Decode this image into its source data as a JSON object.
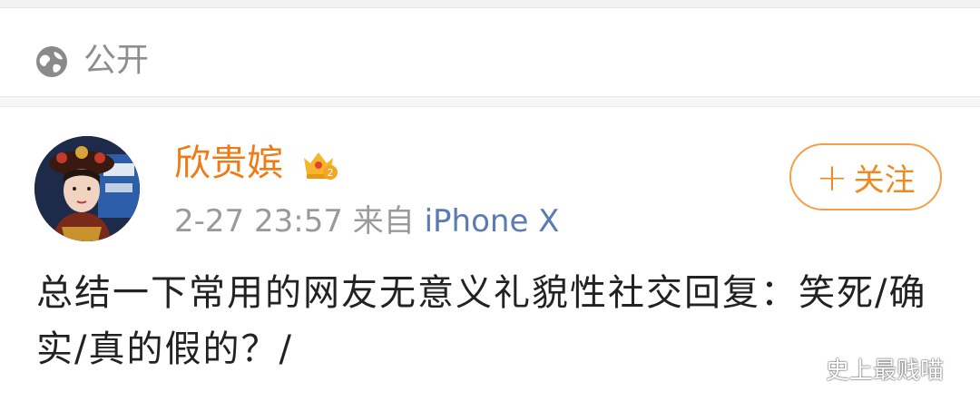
{
  "visibility": {
    "icon": "globe-icon",
    "label": "公开"
  },
  "post": {
    "author": {
      "name": "欣贵嫔",
      "badge_icon": "crown-badge-icon"
    },
    "date": "2-27 23:57",
    "source_prefix": "来自",
    "source_device": "iPhone X",
    "follow_label": "关注",
    "text": "总结一下常用的网友无意义礼貌性社交回复：笑死/确实/真的假的？/"
  },
  "watermark": {
    "icon": "wechat-icon",
    "text": "史上最贱喵"
  },
  "colors": {
    "username": "#f07a14",
    "follow_border": "#f3a046",
    "device_link": "#5b7bb3",
    "muted": "#9a9a9a"
  }
}
